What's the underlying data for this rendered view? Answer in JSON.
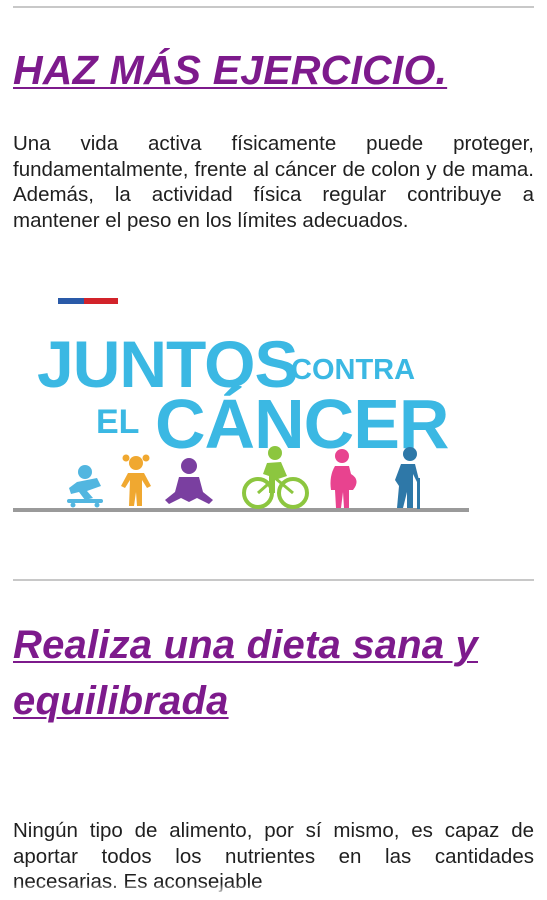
{
  "section1": {
    "title": "HAZ MÁS EJERCICIO.",
    "body": "Una vida activa físicamente puede proteger, fundamentalmente, frente al cáncer de colon y de mama. Además, la actividad física regular contribuye a mantener el peso en los límites adecuados."
  },
  "banner": {
    "line1": "JUNTOS",
    "line1_small": "CONTRA",
    "line2_small": "EL",
    "line2": "CÁNCER",
    "colors": {
      "text": "#3bb8e3",
      "flag_blue": "#2a5aa8",
      "flag_red": "#d2232a",
      "ground": "#9a9a9a",
      "figure1": "#52b6e0",
      "figure2": "#f0a830",
      "figure3": "#7a3fa0",
      "figure4": "#8cc63f",
      "figure5": "#e8438f",
      "figure6": "#2e78a8"
    },
    "figures": [
      "skateboarder-icon",
      "child-icon",
      "meditation-icon",
      "cyclist-icon",
      "pregnant-woman-icon",
      "elder-with-cane-icon"
    ]
  },
  "section2": {
    "title": "Realiza una dieta sana y equilibrada",
    "body": "Ningún tipo de alimento, por sí mismo, es capaz de aportar todos los nutrientes en las cantidades necesarias. Es aconsejable"
  }
}
